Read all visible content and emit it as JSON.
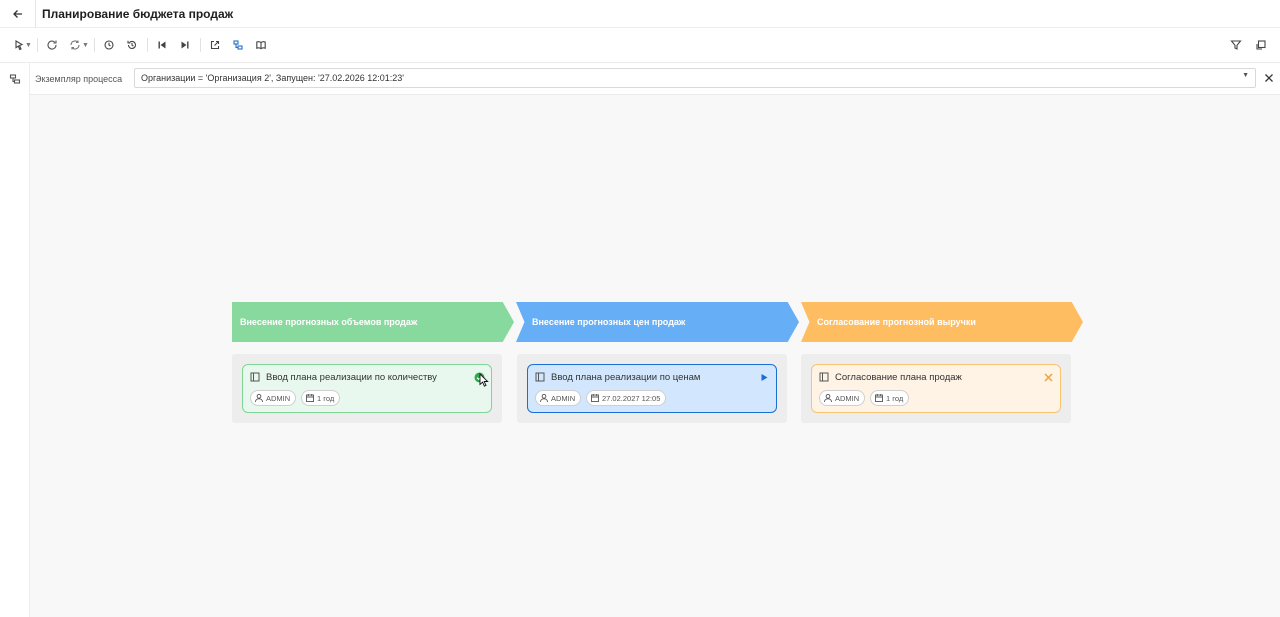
{
  "header": {
    "title": "Планирование бюджета продаж"
  },
  "toolbar": {
    "buttons": [
      "pointer-icon",
      "refresh-icon",
      "sync-icon",
      "history-icon",
      "undo-icon",
      "step-back-icon",
      "step-forward-icon",
      "external-link-icon",
      "diagram-icon",
      "book-icon"
    ],
    "right_buttons": [
      "filter-icon",
      "exit-fullscreen-icon"
    ]
  },
  "instance": {
    "label": "Экземпляр процесса",
    "value": "Организации = 'Организация 2', Запущен: '27.02.2026 12:01:23'"
  },
  "stages": [
    {
      "title": "Внесение прогнозных объемов продаж",
      "color": "#87d99d",
      "task": {
        "title": "Ввод плана реализации по количеству",
        "user": "ADMIN",
        "date": "1 год",
        "status": "completed"
      }
    },
    {
      "title": "Внесение прогнозных цен продаж",
      "color": "#66aef6",
      "task": {
        "title": "Ввод плана реализации по ценам",
        "user": "ADMIN",
        "date": "27.02.2027 12:05",
        "status": "in-progress"
      }
    },
    {
      "title": "Согласование прогнозной выручки",
      "color": "#ffbd62",
      "task": {
        "title": "Согласование плана продаж",
        "user": "ADMIN",
        "date": "1 год",
        "status": "cancelled"
      }
    }
  ]
}
